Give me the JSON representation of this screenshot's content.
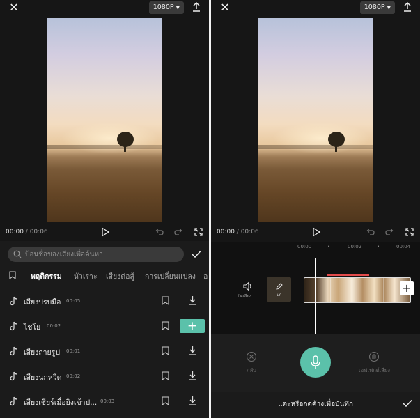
{
  "header": {
    "resolution": "1080P"
  },
  "player": {
    "current_time": "00:00",
    "separator": " / ",
    "total_time": "00:06"
  },
  "left": {
    "search_placeholder": "ป้อนชื่อของเสียงเพื่อค้นหา",
    "tabs": [
      {
        "label": "พฤติกรรม",
        "active": true
      },
      {
        "label": "หัวเราะ",
        "active": false
      },
      {
        "label": "เสียงต่อสู้",
        "active": false
      },
      {
        "label": "การเปลี่ยนแปลง",
        "active": false
      },
      {
        "label": "อ",
        "active": false
      }
    ],
    "sounds": [
      {
        "name": "เสียงปรบมือ",
        "duration": "00:05",
        "state": "download"
      },
      {
        "name": "ไชโย",
        "duration": "00:02",
        "state": "add"
      },
      {
        "name": "เสียงถ่ายรูป",
        "duration": "00:01",
        "state": "download"
      },
      {
        "name": "เสียงนกหวีด",
        "duration": "00:02",
        "state": "download"
      },
      {
        "name": "เสียงเชียร์เมื่อยิงเข้าป...",
        "duration": "00:03",
        "state": "download"
      }
    ],
    "add_label": "+"
  },
  "right": {
    "ruler": [
      "00:00",
      "•",
      "00:02",
      "•",
      "00:04"
    ],
    "mute_label": "ปิดเสียง",
    "cover_label": "ปก",
    "clip_add_label": "+",
    "undo_label": "กลับ",
    "effect_label": "เอฟเฟกต์เสียง",
    "record_hint": "แตะหรือกดค้างเพื่อบันทึก"
  },
  "colors": {
    "accent": "#5bc1aa",
    "marker": "#e24b4b",
    "background": "#161616"
  }
}
